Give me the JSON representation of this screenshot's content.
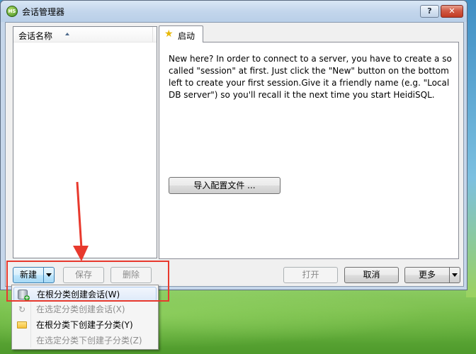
{
  "window": {
    "title": "会话管理器",
    "app_icon_text": "HS",
    "help_glyph": "?",
    "close_glyph": "✕"
  },
  "session_list": {
    "column_header": "会话名称"
  },
  "tab": {
    "label": "启动",
    "welcome_text": "New here? In order to connect to a server, you have to create a so called \"session\" at first. Just click the \"New\" button on the bottom left to create your first session.Give it a friendly name (e.g. \"Local DB server\") so you'll recall it the next time you start HeidiSQL.",
    "import_button": "导入配置文件 ..."
  },
  "buttons": {
    "new": "新建",
    "save": "保存",
    "delete": "删除",
    "open": "打开",
    "cancel": "取消",
    "more": "更多"
  },
  "new_menu": {
    "items": [
      {
        "label": "在根分类创建会话(W)",
        "enabled": true,
        "icon": "database-add-icon"
      },
      {
        "label": "在选定分类创建会话(X)",
        "enabled": false,
        "icon": "refresh-icon"
      },
      {
        "label": "在根分类下创建子分类(Y)",
        "enabled": true,
        "icon": "folder-icon"
      },
      {
        "label": "在选定分类下创建子分类(Z)",
        "enabled": false,
        "icon": ""
      }
    ]
  },
  "annotation_color": "#e8392d"
}
